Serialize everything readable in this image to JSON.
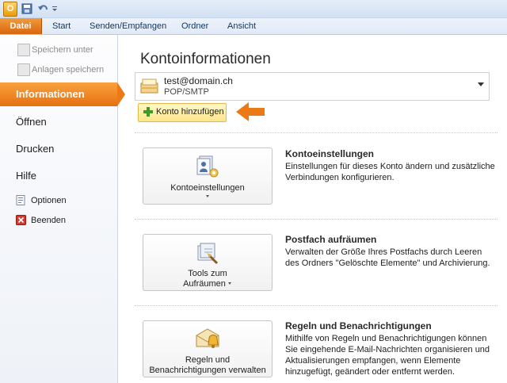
{
  "quick_access": {
    "save_icon": "save-icon",
    "undo_icon": "undo-icon"
  },
  "ribbon_tabs": [
    "Datei",
    "Start",
    "Senden/Empfangen",
    "Ordner",
    "Ansicht"
  ],
  "sidebar": {
    "save_as": "Speichern unter",
    "save_attachments": "Anlagen speichern",
    "active": "Informationen",
    "open": "Öffnen",
    "print": "Drucken",
    "help": "Hilfe",
    "options": "Optionen",
    "exit": "Beenden"
  },
  "main": {
    "title": "Kontoinformationen",
    "account": {
      "email": "test@domain.ch",
      "type": "POP/SMTP"
    },
    "add_account": "Konto hinzufügen",
    "sections": [
      {
        "button_label": "Kontoeinstellungen",
        "title": "Kontoeinstellungen",
        "description": "Einstellungen für dieses Konto ändern und zusätzliche Verbindungen konfigurieren."
      },
      {
        "button_label_line1": "Tools zum",
        "button_label_line2": "Aufräumen",
        "title": "Postfach aufräumen",
        "description": "Verwalten der Größe Ihres Postfachs durch Leeren des Ordners \"Gelöschte Elemente\" und Archivierung."
      },
      {
        "button_label_line1": "Regeln und",
        "button_label_line2": "Benachrichtigungen verwalten",
        "title": "Regeln und Benachrichtigungen",
        "description": "Mithilfe von Regeln und Benachrichtigungen können Sie eingehende E-Mail-Nachrichten organisieren und Aktualisierungen empfangen, wenn Elemente hinzugefügt, geändert oder entfernt werden."
      }
    ]
  },
  "colors": {
    "accent": "#e6700f",
    "ribbon": "#dfe9f6",
    "highlight": "#fde58a"
  }
}
